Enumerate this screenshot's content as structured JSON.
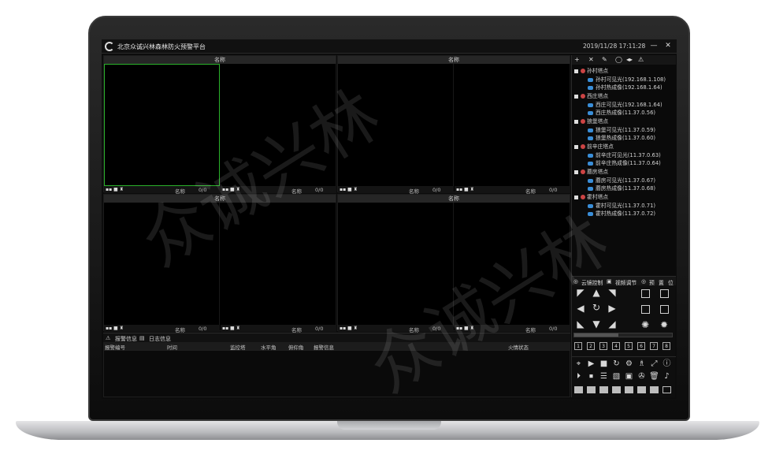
{
  "window": {
    "title": "北京众诚兴林森林防火预警平台",
    "datetime": "2019/11/28 17:11:28",
    "minimize": "—",
    "close": "✕"
  },
  "video": {
    "pane_header": "名称",
    "cell_name": "名称",
    "cell_count": "0/0"
  },
  "alarm": {
    "tab_alarm": "报警信息",
    "tab_log": "日志信息",
    "columns": [
      "报警编号",
      "时间",
      "监控塔",
      "水平角",
      "俯仰角",
      "报警信息",
      "火情状态"
    ]
  },
  "tree": {
    "tools": [
      "+",
      "✕",
      "✎",
      "◯",
      "◂▸",
      "⚠"
    ],
    "groups": [
      {
        "name": "孙村塔点",
        "cams": [
          "孙村可见光(192.168.1.108)",
          "孙村热成像(192.168.1.64)"
        ]
      },
      {
        "name": "西庄塔点",
        "cams": [
          "西庄可见光(192.168.1.64)",
          "西庄热成像(11.37.0.56)"
        ]
      },
      {
        "name": "狼堡塔点",
        "cams": [
          "狼堡可见光(11.37.0.59)",
          "狼堡热成像(11.37.0.60)"
        ]
      },
      {
        "name": "前辛庄塔点",
        "cams": [
          "前辛庄可见光(11.37.0.63)",
          "前辛庄热成像(11.37.0.64)"
        ]
      },
      {
        "name": "蘑房塔点",
        "cams": [
          "蘑房可见光(11.37.0.67)",
          "蘑房热成像(11.37.0.68)"
        ]
      },
      {
        "name": "霍村塔点",
        "cams": [
          "霍村可见光(11.37.0.71)",
          "霍村热成像(11.37.0.72)"
        ]
      }
    ]
  },
  "control": {
    "tab_ptz": "云镜控制",
    "tab_video": "视频调节",
    "tab_preset1": "预",
    "tab_preset2": "置",
    "tab_pos": "位",
    "presets": [
      "1",
      "2",
      "3",
      "4",
      "5",
      "6",
      "7",
      "8"
    ],
    "speed_level": 0.45
  },
  "watermark": {
    "text1": "众诚兴林",
    "text2": "众诚兴林"
  }
}
